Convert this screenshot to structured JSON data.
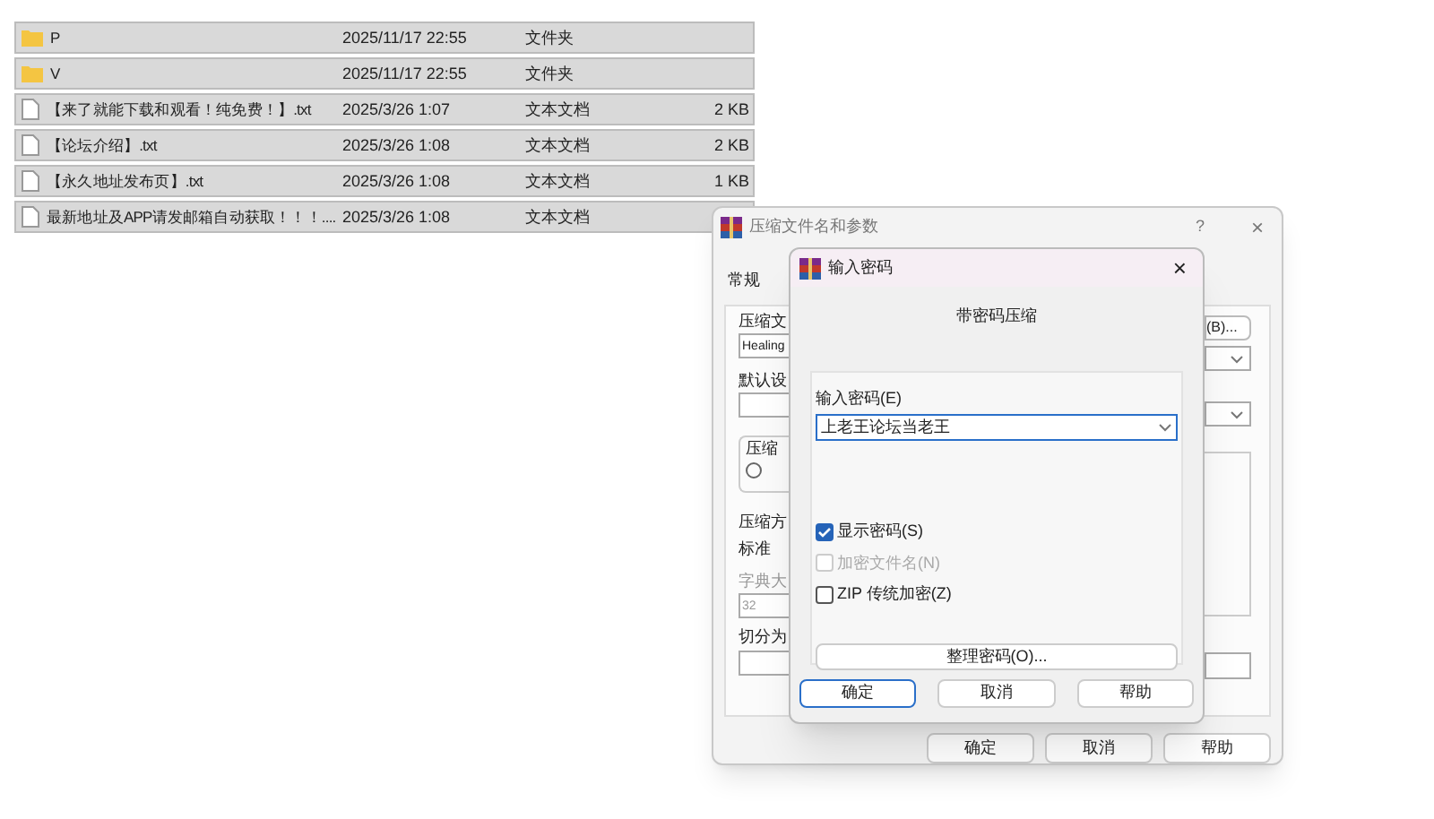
{
  "files": [
    {
      "kind": "folder",
      "name": "P",
      "date": "2025/11/17 22:55",
      "type": "文件夹"
    },
    {
      "kind": "folder",
      "name": "V",
      "date": "2025/11/17 22:55",
      "type": "文件夹"
    },
    {
      "kind": "text",
      "name": "【来了就能下载和观看！纯免费！】.txt",
      "date": "2025/3/26 1:07",
      "type": "文本文档",
      "size": "2 KB"
    },
    {
      "kind": "text",
      "name": "【论坛介绍】.txt",
      "date": "2025/3/26 1:08",
      "type": "文本文档",
      "size": "2 KB"
    },
    {
      "kind": "text",
      "name": "【永久地址发布页】.txt",
      "date": "2025/3/26 1:08",
      "type": "文本文档",
      "size": "1 KB"
    },
    {
      "kind": "text",
      "name": "最新地址及APP请发邮箱自动获取！！！....",
      "date": "2025/3/26 1:08",
      "type": "文本文档"
    }
  ],
  "archive_dialog": {
    "title": "压缩文件名和参数",
    "help": "?",
    "close": "×",
    "tab": "常规",
    "left_labels": [
      {
        "kind": "label",
        "text": "压缩文"
      },
      {
        "kind": "field",
        "text": "Healing"
      },
      {
        "kind": "label",
        "text": "默认设"
      },
      {
        "kind": "field"
      },
      {
        "kind": "group",
        "text": "压缩",
        "selected": false
      },
      {
        "kind": "label",
        "text": "压缩方"
      },
      {
        "kind": "value",
        "text": "标准"
      },
      {
        "kind": "label_disabled",
        "text": "字典大"
      },
      {
        "kind": "field_disabled",
        "text": "32"
      },
      {
        "kind": "label",
        "text": "切分为"
      },
      {
        "kind": "field"
      }
    ],
    "right_button": "(B)...",
    "buttons": [
      "确定",
      "取消",
      "帮助"
    ]
  },
  "password_dialog": {
    "title": "输入密码",
    "close": "×",
    "heading": "带密码压缩",
    "field_label": "输入密码(E)",
    "password": "上老王论坛当老王",
    "options": [
      {
        "label": "显示密码(S)",
        "checked": true,
        "disabled": false
      },
      {
        "label": "加密文件名(N)",
        "checked": false,
        "disabled": true
      },
      {
        "label": "ZIP 传统加密(Z)",
        "checked": false,
        "disabled": false
      }
    ],
    "organize_button": "整理密码(O)...",
    "buttons": [
      {
        "label": "确定",
        "selected": true
      },
      {
        "label": "取消",
        "selected": false
      },
      {
        "label": "帮助",
        "selected": false
      }
    ]
  }
}
